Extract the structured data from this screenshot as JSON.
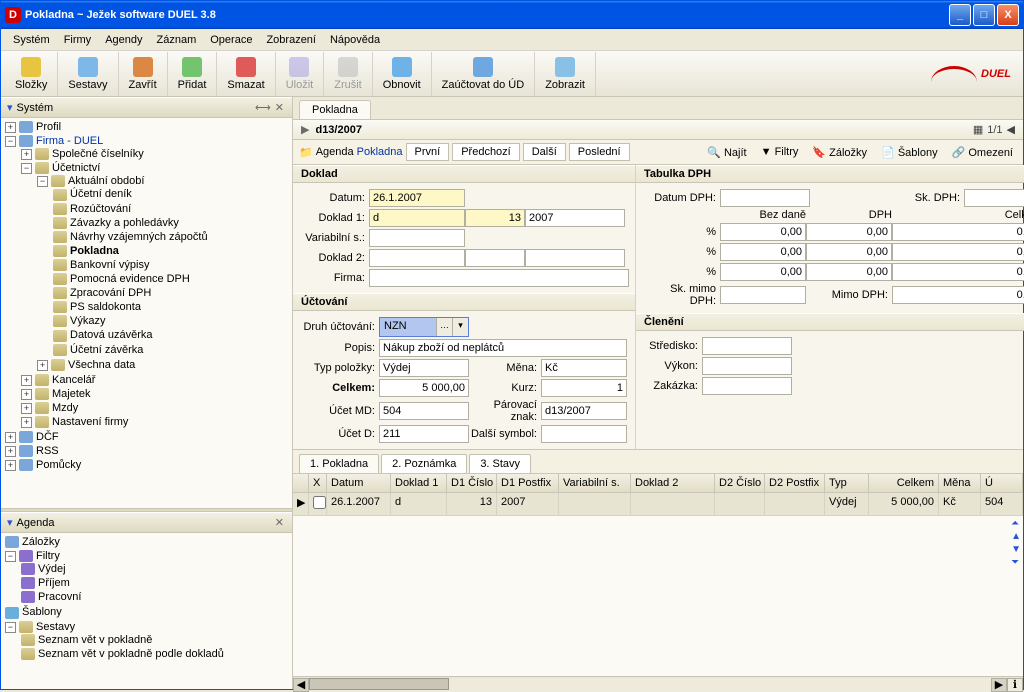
{
  "window_title": "Pokladna ~ Ježek software DUEL 3.8",
  "menubar": [
    "Systém",
    "Firmy",
    "Agendy",
    "Záznam",
    "Operace",
    "Zobrazení",
    "Nápověda"
  ],
  "toolbar": [
    {
      "label": "Složky",
      "id": "slozky"
    },
    {
      "label": "Sestavy",
      "id": "sestavy"
    },
    {
      "label": "Zavřít",
      "id": "zavrit"
    },
    {
      "label": "Přidat",
      "id": "pridat"
    },
    {
      "label": "Smazat",
      "id": "smazat"
    },
    {
      "label": "Uložit",
      "id": "ulozit",
      "disabled": true
    },
    {
      "label": "Zrušit",
      "id": "zrusit",
      "disabled": true
    },
    {
      "label": "Obnovit",
      "id": "obnovit"
    },
    {
      "label": "Zaúčtovat do ÚD",
      "id": "zauctovat"
    },
    {
      "label": "Zobrazit",
      "id": "zobrazit"
    }
  ],
  "logo": "DUEL",
  "left_panels": {
    "system": "Systém",
    "agenda": "Agenda"
  },
  "tree_system": {
    "profil": "Profil",
    "firma": "Firma - DUEL",
    "spolecne": "Společné číselníky",
    "ucetnictvi": "Účetnictví",
    "aktualni": "Aktuální období",
    "ucetni_denik": "Účetní deník",
    "rozuctovani": "Rozúčtování",
    "zavazky": "Závazky a pohledávky",
    "navrhy": "Návrhy vzájemných zápočtů",
    "pokladna": "Pokladna",
    "bankovni": "Bankovní výpisy",
    "pomocna": "Pomocná evidence DPH",
    "zpracovani": "Zpracování DPH",
    "ps": "PS saldokonta",
    "vykazy": "Výkazy",
    "datova": "Datová uzávěrka",
    "ucetni_uz": "Účetní závěrka",
    "vsechna": "Všechna data",
    "kancelar": "Kancelář",
    "majetek": "Majetek",
    "mzdy": "Mzdy",
    "nastaveni": "Nastavení firmy",
    "dcf": "DČF",
    "rss": "RSS",
    "pomucky": "Pomůcky"
  },
  "tree_agenda": {
    "zalozky": "Záložky",
    "filtry": "Filtry",
    "vydej": "Výdej",
    "prijem": "Příjem",
    "pracovni": "Pracovní",
    "sablony": "Šablony",
    "sestavy": "Sestavy",
    "seznam1": "Seznam vět v pokladně",
    "seznam2": "Seznam vět v pokladně podle dokladů"
  },
  "tabname": "Pokladna",
  "record_id": "d13/2007",
  "pager": "1/1",
  "navbar": {
    "agenda_lbl": "Agenda",
    "agenda_val": "Pokladna",
    "first": "První",
    "prev": "Předchozí",
    "next": "Další",
    "last": "Poslední",
    "find": "Najít",
    "filtry": "Filtry",
    "zalozky": "Záložky",
    "sablony": "Šablony",
    "omezeni": "Omezení"
  },
  "doklad": {
    "title": "Doklad",
    "datum_l": "Datum:",
    "datum_v": "26.1.2007",
    "doklad1_l": "Doklad 1:",
    "doklad1_a": "d",
    "doklad1_b": "13",
    "doklad1_c": "2007",
    "vs_l": "Variabilní s.:",
    "doklad2_l": "Doklad 2:",
    "firma_l": "Firma:"
  },
  "dph": {
    "title": "Tabulka DPH",
    "datum_l": "Datum DPH:",
    "sk_l": "Sk. DPH:",
    "bez": "Bez daně",
    "dph": "DPH",
    "celkem": "Celkem",
    "pct": "%",
    "v": "0,00",
    "skmimo_l": "Sk. mimo DPH:",
    "mimo_l": "Mimo DPH:"
  },
  "uctovani": {
    "title": "Účtování",
    "druh_l": "Druh účtování:",
    "druh_v": "NZN",
    "popis_l": "Popis:",
    "popis_v": "Nákup zboží od neplátců",
    "typ_l": "Typ položky:",
    "typ_v": "Výdej",
    "mena_l": "Měna:",
    "mena_v": "Kč",
    "celkem_l": "Celkem:",
    "celkem_v": "5 000,00",
    "kurz_l": "Kurz:",
    "kurz_v": "1",
    "umd_l": "Účet MD:",
    "umd_v": "504",
    "pz_l": "Párovací znak:",
    "pz_v": "d13/2007",
    "ud_l": "Účet D:",
    "ud_v": "211",
    "ds_l": "Další symbol:"
  },
  "cleneni": {
    "title": "Členění",
    "stredisko": "Středisko:",
    "vykon": "Výkon:",
    "zakazka": "Zakázka:"
  },
  "subtabs": [
    "1. Pokladna",
    "2. Poznámka",
    "3. Stavy"
  ],
  "grid_cols": [
    "",
    "X",
    "Datum",
    "Doklad 1",
    "D1 Číslo",
    "D1 Postfix",
    "Variabilní s.",
    "Doklad 2",
    "D2 Číslo",
    "D2 Postfix",
    "Typ",
    "Celkem",
    "Měna",
    "Ú"
  ],
  "grid_row": {
    "datum": "26.1.2007",
    "d1": "d",
    "d1c": "13",
    "d1p": "2007",
    "typ": "Výdej",
    "celkem": "5 000,00",
    "mena": "Kč",
    "u": "504"
  }
}
